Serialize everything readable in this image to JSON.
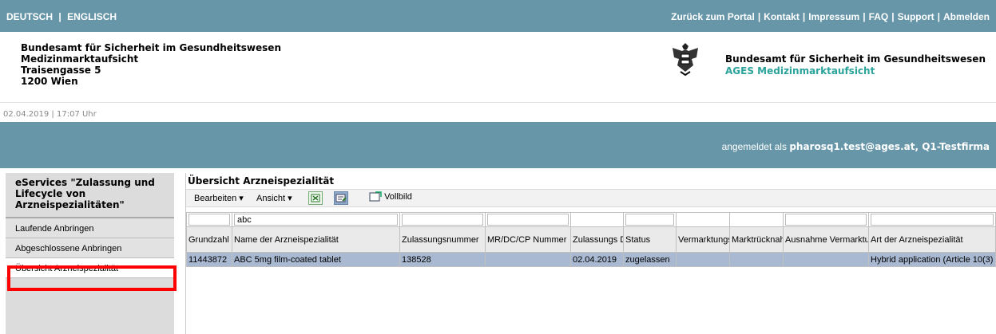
{
  "topbar": {
    "lang_de": "DEUTSCH",
    "lang_sep": "|",
    "lang_en": "ENGLISCH",
    "links": [
      "Zurück zum Portal",
      "Kontakt",
      "Impressum",
      "FAQ",
      "Support",
      "Abmelden"
    ]
  },
  "header": {
    "address": [
      "Bundesamt für Sicherheit im Gesundheitswesen",
      "Medizinmarktaufsicht",
      "Traisengasse 5",
      "1200 Wien"
    ],
    "brand_title": "Bundesamt für Sicherheit im Gesundheitswesen",
    "brand_sub": "AGES Medizinmarktaufsicht"
  },
  "dateline": "02.04.2019 | 17:07 Uhr",
  "user": {
    "prefix": "angemeldet als",
    "name": "pharosq1.test@ages.at, Q1-Testfirma"
  },
  "sidebar": {
    "title": "eServices \"Zulassung und Lifecycle von Arzneispezialitäten\"",
    "items": [
      "Laufende Anbringen",
      "Abgeschlossene Anbringen",
      "Übersicht Arzneispezialität"
    ]
  },
  "panel": {
    "title": "Übersicht Arzneispezialität",
    "toolbar": {
      "edit": "Bearbeiten",
      "view": "Ansicht",
      "fullscreen": "Vollbild"
    }
  },
  "table": {
    "filters": [
      "",
      "abc",
      "",
      "",
      "",
      "",
      "",
      "",
      "",
      ""
    ],
    "headers": [
      "Grundzahl",
      "Name der Arzneispezialität",
      "Zulassungsnummer",
      "MR/DC/CP Nummer",
      "Zulassungs Datum",
      "Status",
      "Vermarktungs Datum",
      "Marktrücknahme Datum",
      "Ausnahme Vermarktung",
      "Art der Arzneispezialität"
    ],
    "rows": [
      [
        "11443872",
        "ABC 5mg film-coated tablet",
        "138528",
        "",
        "02.04.2019",
        "zugelassen",
        "",
        "",
        "",
        "Hybrid application (Article 10(3)"
      ]
    ]
  },
  "colors": {
    "bar": "#6796a8",
    "brand_sub": "#2aa39b",
    "selected_row": "#a9b9d2",
    "highlight": "#ff0000"
  }
}
